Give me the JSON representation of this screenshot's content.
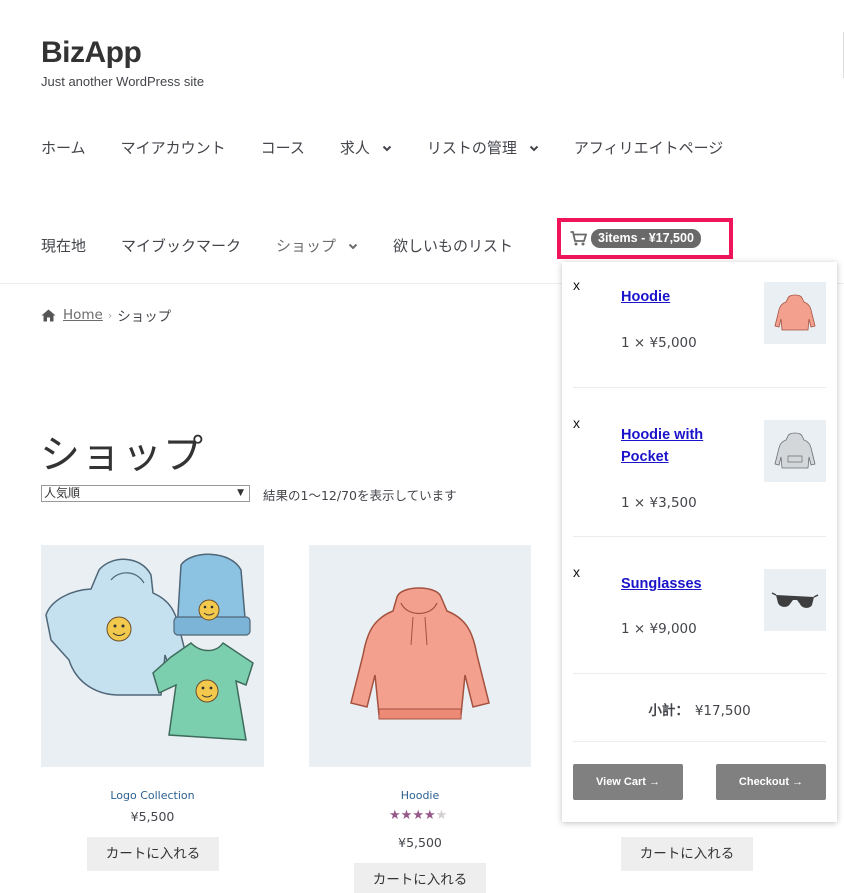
{
  "site": {
    "title": "BizApp",
    "tagline": "Just another WordPress site"
  },
  "nav": {
    "row1": [
      {
        "label": "ホーム",
        "dropdown": false
      },
      {
        "label": "マイアカウント",
        "dropdown": false
      },
      {
        "label": "コース",
        "dropdown": false
      },
      {
        "label": "求人",
        "dropdown": true
      },
      {
        "label": "リストの管理",
        "dropdown": true
      },
      {
        "label": "アフィリエイトページ",
        "dropdown": false
      }
    ],
    "row2": [
      {
        "label": "現在地",
        "dropdown": false
      },
      {
        "label": "マイブックマーク",
        "dropdown": false
      },
      {
        "label": "ショップ",
        "dropdown": true
      },
      {
        "label": "欲しいものリスト",
        "dropdown": false
      }
    ]
  },
  "cart": {
    "summary": "3items - ¥17,500",
    "items": [
      {
        "name": "Hoodie",
        "qty": "1 × ¥5,000",
        "remove": "x",
        "icon": "hoodie-pink-icon"
      },
      {
        "name": "Hoodie with Pocket",
        "qty": "1 × ¥3,500",
        "remove": "x",
        "icon": "hoodie-grey-icon"
      },
      {
        "name": "Sunglasses",
        "qty": "1 × ¥9,000",
        "remove": "x",
        "icon": "sunglasses-icon"
      }
    ],
    "subtotal_label": "小計：",
    "subtotal_value": "¥17,500",
    "view_cart": "View Cart →",
    "checkout": "Checkout →"
  },
  "breadcrumb": {
    "home": "Home",
    "current": "ショップ"
  },
  "page": {
    "title": "ショップ",
    "orderby": "人気順",
    "result_count": "結果の1～12/70を表示しています"
  },
  "products": [
    {
      "name": "Logo Collection",
      "price": "¥5,500",
      "button": "カートに入れる"
    },
    {
      "name": "Hoodie",
      "price": "¥5,500",
      "button": "カートに入れる",
      "rating": 4
    },
    {
      "name": "",
      "price": "",
      "button": "カートに入れる"
    }
  ],
  "colors": {
    "highlight": "#f0145a",
    "link": "#1a13c9",
    "star": "#96588a",
    "button": "#808080"
  }
}
